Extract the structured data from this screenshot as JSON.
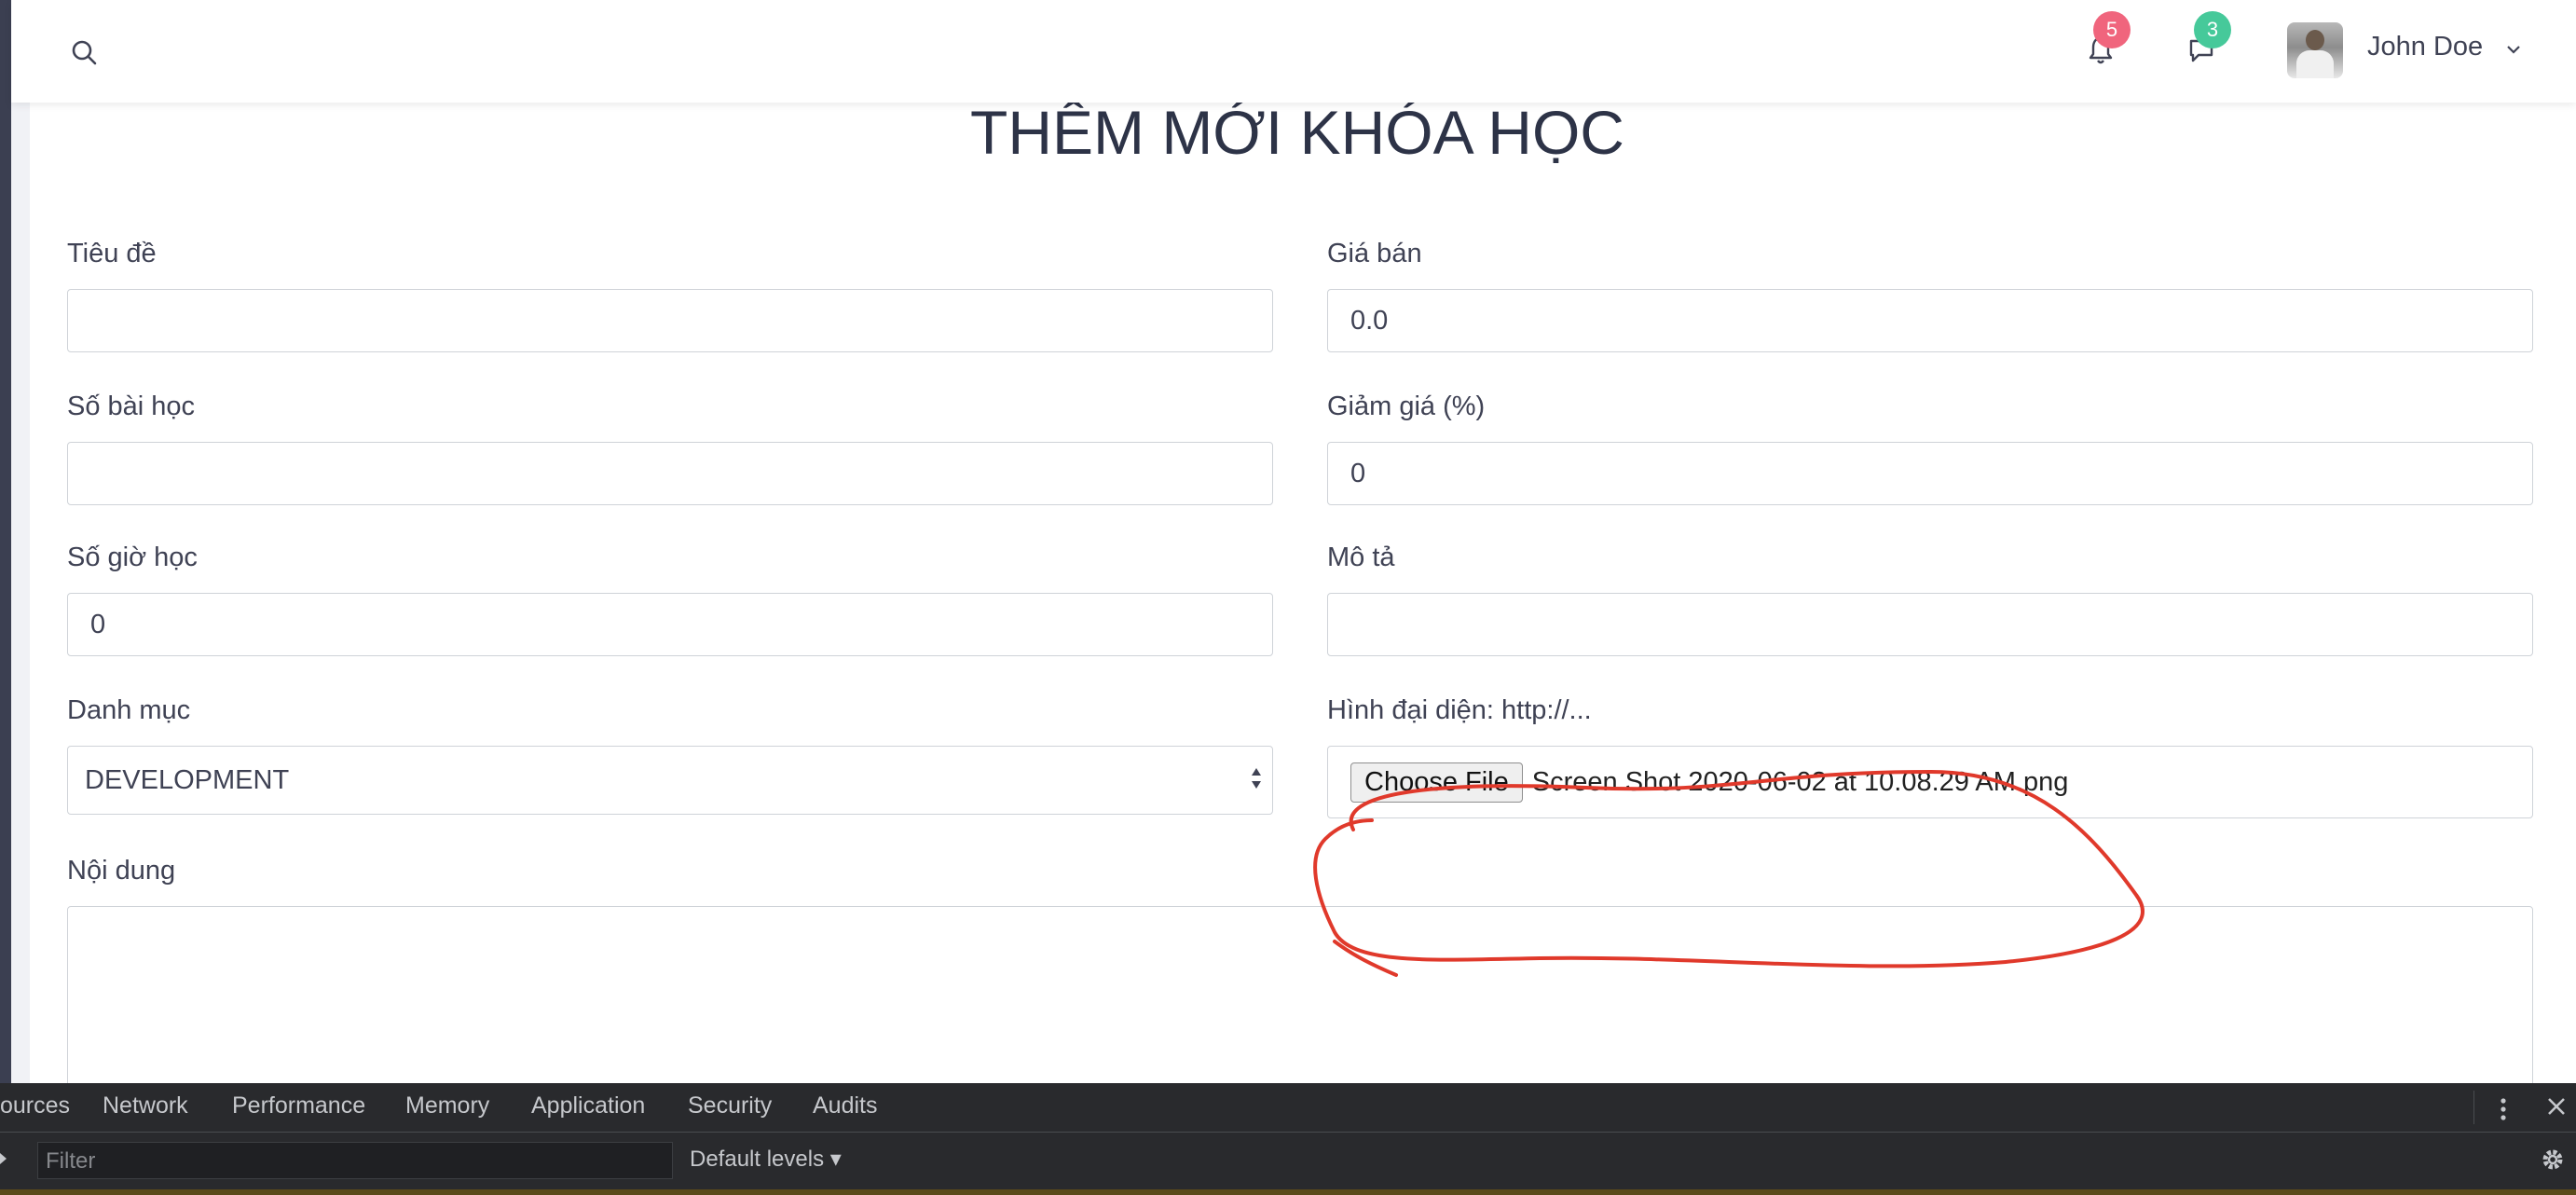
{
  "header": {
    "notifications_count": "5",
    "messages_count": "3",
    "user_name": "John Doe"
  },
  "page": {
    "title": "THÊM MỚI KHÓA HỌC"
  },
  "form": {
    "title_label": "Tiêu đề",
    "title_value": "",
    "price_label": "Giá bán",
    "price_value": "0.0",
    "lessons_label": "Số bài học",
    "lessons_value": "",
    "discount_label": "Giảm giá (%)",
    "discount_value": "0",
    "hours_label": "Số giờ học",
    "hours_value": "0",
    "description_label": "Mô tả",
    "description_value": "",
    "category_label": "Danh mục",
    "category_value": "DEVELOPMENT",
    "image_label": "Hình đại diện: http://...",
    "choose_file_label": "Choose File",
    "file_name": "Screen Shot 2020-06-02 at 10.08.29 AM.png",
    "content_label": "Nội dung",
    "content_value": ""
  },
  "annotation": {
    "color": "#e0392b"
  },
  "devtools": {
    "tabs": [
      "ources",
      "Network",
      "Performance",
      "Memory",
      "Application",
      "Security",
      "Audits"
    ],
    "filter_placeholder": "Filter",
    "levels_label": "Default levels ▾"
  }
}
